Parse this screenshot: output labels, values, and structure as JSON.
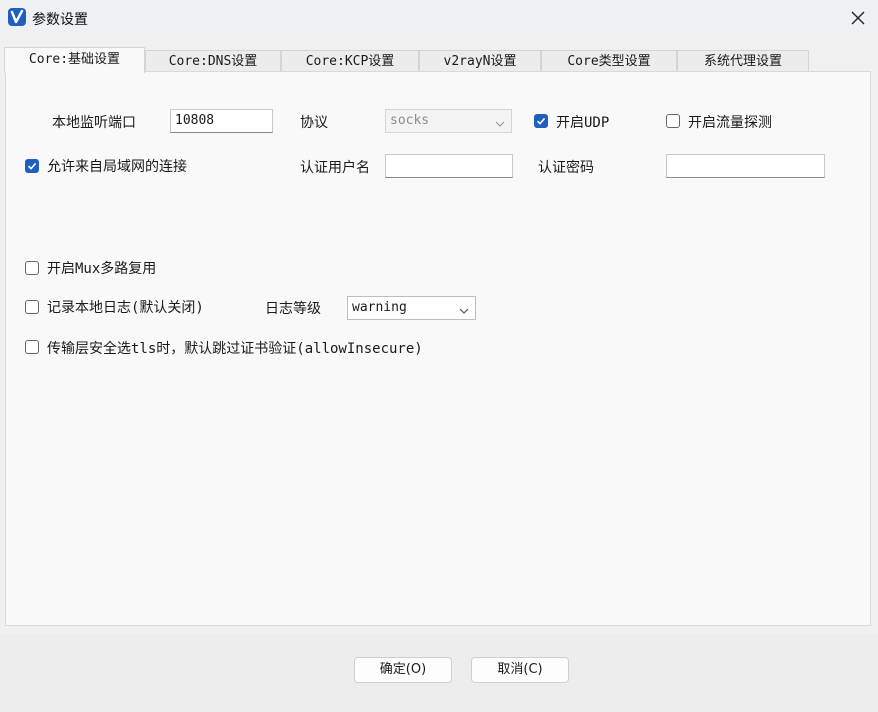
{
  "window": {
    "title": "参数设置",
    "app_icon": "v2rayn-app-icon",
    "close_icon": "close-icon"
  },
  "tabs": [
    {
      "label": "Core:基础设置",
      "active": true
    },
    {
      "label": "Core:DNS设置",
      "active": false
    },
    {
      "label": "Core:KCP设置",
      "active": false
    },
    {
      "label": "v2rayN设置",
      "active": false
    },
    {
      "label": "Core类型设置",
      "active": false
    },
    {
      "label": "系统代理设置",
      "active": false
    }
  ],
  "form": {
    "local_port_label": "本地监听端口",
    "local_port_value": "10808",
    "protocol_label": "协议",
    "protocol_value": "socks",
    "enable_udp_label": "开启UDP",
    "enable_udp_checked": true,
    "enable_sniffing_label": "开启流量探测",
    "enable_sniffing_checked": false,
    "allow_lan_label": "允许来自局域网的连接",
    "allow_lan_checked": true,
    "auth_user_label": "认证用户名",
    "auth_user_value": "",
    "auth_pass_label": "认证密码",
    "auth_pass_value": "",
    "mux_label": "开启Mux多路复用",
    "mux_checked": false,
    "log_label": "记录本地日志(默认关闭)",
    "log_checked": false,
    "log_level_label": "日志等级",
    "log_level_value": "warning",
    "allow_insecure_label": "传输层安全选tls时，默认跳过证书验证(allowInsecure)",
    "allow_insecure_checked": false
  },
  "buttons": {
    "ok": "确定(O)",
    "cancel": "取消(C)"
  },
  "colors": {
    "accent": "#1f5fbf",
    "panel_bg": "#f9f9f9",
    "window_bg": "#f0f0f0"
  }
}
